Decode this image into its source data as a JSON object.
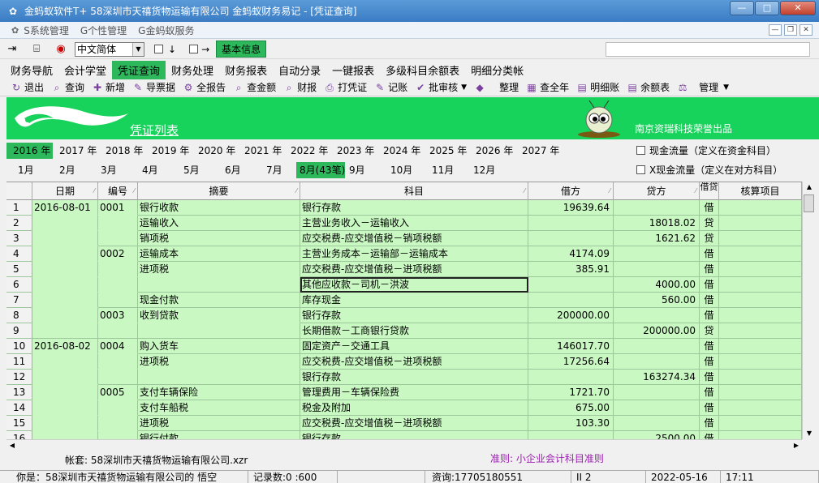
{
  "window": {
    "title": "金蚂蚁软件T+ 58深圳市天禧货物运输有限公司 金蚂蚁财务易记 - [凭证查询]",
    "app_icon": "ant-logo-icon"
  },
  "menubar": {
    "items": [
      "S系统管理",
      "G个性管理",
      "G金蚂蚁服务"
    ]
  },
  "toolbar1": {
    "language": "中文简体",
    "basic_info": "基本信息",
    "arrow_down": "↓",
    "arrow_right": "→"
  },
  "nav": [
    "财务导航",
    "会计学堂",
    "凭证查询",
    "财务处理",
    "财务报表",
    "自动分录",
    "一键报表",
    "多级科目余额表",
    "明细分类帐"
  ],
  "nav_active": 2,
  "actions": [
    "退出",
    "查询",
    "新增",
    "导票据",
    "全报告",
    "查金额",
    "财报",
    "打凭证",
    "记账",
    "批审核",
    "整理",
    "查全年",
    "明细账",
    "余额表",
    "管理"
  ],
  "banner": {
    "title": "凭证列表",
    "credit": "南京资瑞科技荣誉出品"
  },
  "years": [
    "2016 年",
    "2017 年",
    "2018 年",
    "2019 年",
    "2020 年",
    "2021 年",
    "2022 年",
    "2023 年",
    "2024 年",
    "2025 年",
    "2026 年",
    "2027 年"
  ],
  "year_active": 0,
  "months": [
    "1月",
    "2月",
    "3月",
    "4月",
    "5月",
    "6月",
    "7月",
    "8月(43笔)",
    "9月",
    "10月",
    "11月",
    "12月"
  ],
  "month_active": 7,
  "options": {
    "cash_flow": "现金流量（定义在资金科目）",
    "x_cash_flow": "X现金流量（定义在对方科目）"
  },
  "columns": [
    "日期",
    "编号",
    "摘要",
    "科目",
    "借方",
    "贷方",
    "借贷",
    "核算项目"
  ],
  "rows": [
    {
      "n": "1",
      "date": "2016-08-01",
      "no": "0001",
      "memo": "银行收款",
      "acct": "银行存款",
      "debit": "19639.64",
      "credit": "",
      "dc": "借"
    },
    {
      "n": "2",
      "date": "",
      "no": "",
      "memo": "运输收入",
      "acct": "主营业务收入－运输收入",
      "debit": "",
      "credit": "18018.02",
      "dc": "贷"
    },
    {
      "n": "3",
      "date": "",
      "no": "",
      "memo": "销项税",
      "acct": "应交税费-应交增值税－销项税额",
      "debit": "",
      "credit": "1621.62",
      "dc": "贷"
    },
    {
      "n": "4",
      "date": "",
      "no": "0002",
      "memo": "运输成本",
      "acct": "主营业务成本－运输部－运输成本",
      "debit": "4174.09",
      "credit": "",
      "dc": "借"
    },
    {
      "n": "5",
      "date": "",
      "no": "",
      "memo": "进项税",
      "acct": "应交税费-应交增值税－进项税额",
      "debit": "385.91",
      "credit": "",
      "dc": "借"
    },
    {
      "n": "6",
      "date": "",
      "no": "",
      "memo": "",
      "acct": "其他应收款－司机－洪波",
      "debit": "",
      "credit": "4000.00",
      "dc": "借"
    },
    {
      "n": "7",
      "date": "",
      "no": "",
      "memo": "现金付款",
      "acct": "库存现金",
      "debit": "",
      "credit": "560.00",
      "dc": "借"
    },
    {
      "n": "8",
      "date": "",
      "no": "0003",
      "memo": "收到贷款",
      "acct": "银行存款",
      "debit": "200000.00",
      "credit": "",
      "dc": "借"
    },
    {
      "n": "9",
      "date": "",
      "no": "",
      "memo": "",
      "acct": "长期借款－工商银行贷款",
      "debit": "",
      "credit": "200000.00",
      "dc": "贷"
    },
    {
      "n": "10",
      "date": "2016-08-02",
      "no": "0004",
      "memo": "购入货车",
      "acct": "固定资产－交通工具",
      "debit": "146017.70",
      "credit": "",
      "dc": "借"
    },
    {
      "n": "11",
      "date": "",
      "no": "",
      "memo": "进项税",
      "acct": "应交税费-应交增值税－进项税额",
      "debit": "17256.64",
      "credit": "",
      "dc": "借"
    },
    {
      "n": "12",
      "date": "",
      "no": "",
      "memo": "",
      "acct": "银行存款",
      "debit": "",
      "credit": "163274.34",
      "dc": "借"
    },
    {
      "n": "13",
      "date": "",
      "no": "0005",
      "memo": "支付车辆保险",
      "acct": "管理费用－车辆保险费",
      "debit": "1721.70",
      "credit": "",
      "dc": "借"
    },
    {
      "n": "14",
      "date": "",
      "no": "",
      "memo": "支付车船税",
      "acct": "税金及附加",
      "debit": "675.00",
      "credit": "",
      "dc": "借"
    },
    {
      "n": "15",
      "date": "",
      "no": "",
      "memo": "进项税",
      "acct": "应交税费-应交增值税－进项税额",
      "debit": "103.30",
      "credit": "",
      "dc": "借"
    },
    {
      "n": "16",
      "date": "",
      "no": "",
      "memo": "银行付款",
      "acct": "银行存款",
      "debit": "",
      "credit": "2500.00",
      "dc": "借"
    }
  ],
  "footer": {
    "account": "帐套: 58深圳市天禧货物运输有限公司.xzr",
    "standard": "准则: 小企业会计科目准则"
  },
  "status": [
    "你是：58深圳市天禧货物运输有限公司的 悟空",
    "记录数:0 :600",
    "",
    "资询:17705180551",
    "II 2",
    "2022-05-16",
    "17:11"
  ]
}
